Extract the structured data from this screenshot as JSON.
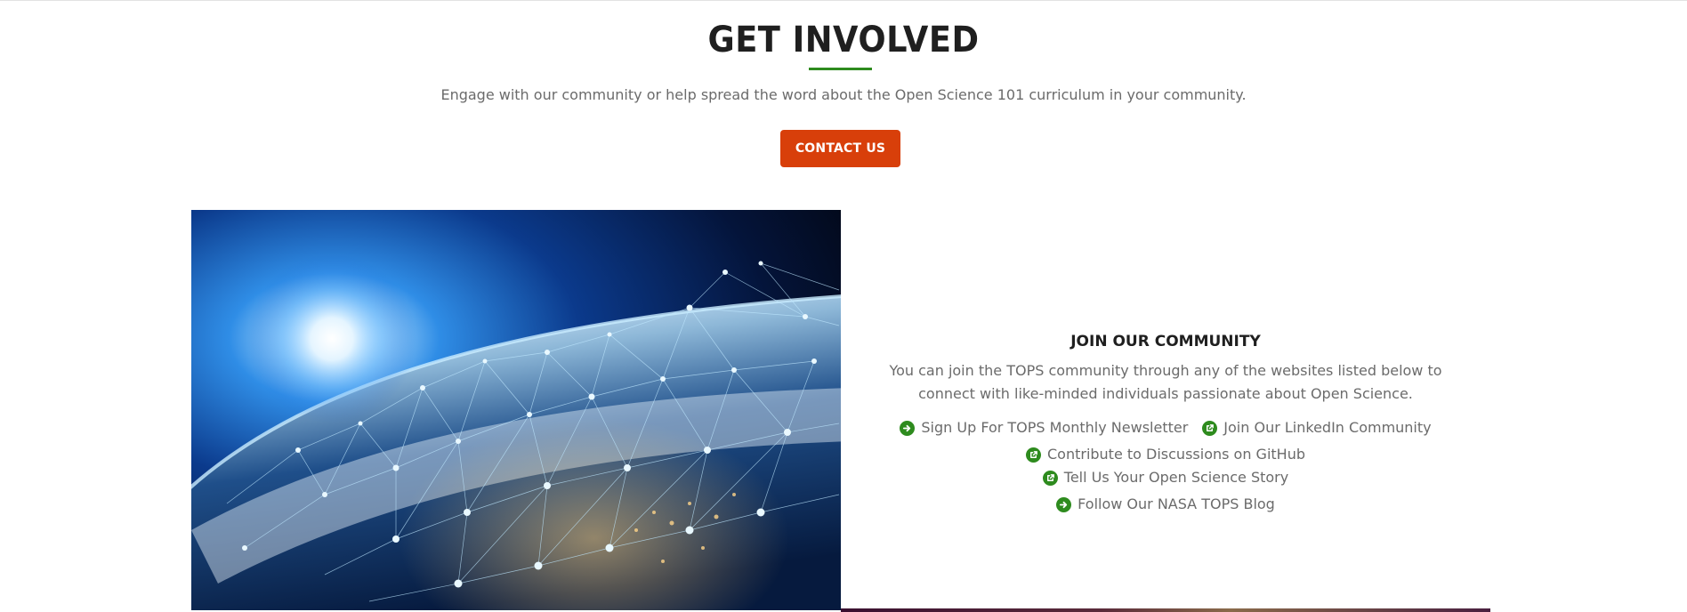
{
  "section": {
    "title": "GET INVOLVED",
    "intro": "Engage with our community or help spread the word about the Open Science 101 curriculum in your community.",
    "contact_button": "CONTACT US"
  },
  "community": {
    "title": "JOIN OUR COMMUNITY",
    "description": "You can join the TOPS community through any of the websites listed below to connect with like-minded individuals passionate about Open Science.",
    "links": [
      {
        "label": "Sign Up For TOPS Monthly Newsletter",
        "icon": "arrow-right-circle-icon"
      },
      {
        "label": "Join Our LinkedIn Community",
        "icon": "external-link-icon"
      },
      {
        "label": "Contribute to Discussions on GitHub",
        "icon": "external-link-icon"
      },
      {
        "label": "Tell Us Your Open Science Story",
        "icon": "external-link-icon"
      },
      {
        "label": "Follow Our NASA TOPS Blog",
        "icon": "arrow-right-circle-icon"
      }
    ]
  },
  "colors": {
    "accent_green": "#2e8b1e",
    "button_orange": "#d83f0a",
    "heading": "#1f1f1f",
    "body_text": "#6b6b6b"
  }
}
